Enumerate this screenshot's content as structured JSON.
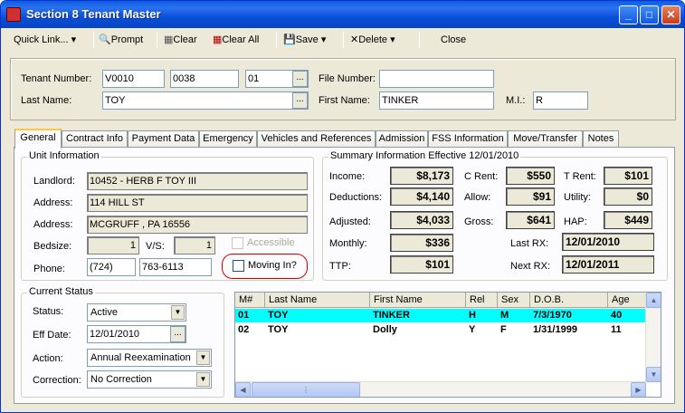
{
  "window": {
    "title": "Section 8 Tenant Master",
    "minimize": "_",
    "maximize": "□",
    "close": "✕"
  },
  "toolbar": {
    "quick_link": "Quick Link...",
    "prompt": "Prompt",
    "clear": "Clear",
    "clear_all": "Clear All",
    "save": "Save",
    "delete": "Delete",
    "close": "Close"
  },
  "header": {
    "tenant_number_label": "Tenant Number:",
    "tenant_number_1": "V0010",
    "tenant_number_2": "0038",
    "tenant_number_3": "01",
    "file_number_label": "File Number:",
    "file_number": "",
    "last_name_label": "Last Name:",
    "last_name": "TOY",
    "first_name_label": "First Name:",
    "first_name": "TINKER",
    "mi_label": "M.I.:",
    "mi": "R",
    "ellipsis": "..."
  },
  "tabs": [
    "General",
    "Contract Info",
    "Payment Data",
    "Emergency",
    "Vehicles and References",
    "Admission",
    "FSS Information",
    "Move/Transfer",
    "Notes"
  ],
  "unit": {
    "group_label": "Unit Information",
    "landlord_label": "Landlord:",
    "landlord": "10452    -  HERB F TOY III",
    "address_label": "Address:",
    "address1": "114 HILL ST",
    "address2_label": "Address:",
    "address2": "MCGRUFF          , PA  16556",
    "bedsize_label": "Bedsize:",
    "bedsize": "1",
    "vs_label": "V/S:",
    "vs": "1",
    "accessible_label": "Accessible",
    "phone_label": "Phone:",
    "phone_area": "(724)",
    "phone_number": "763-6113",
    "moving_in_label": "Moving In?"
  },
  "summary": {
    "group_label": "Summary Information Effective 12/01/2010",
    "income_label": "Income:",
    "income": "$8,173",
    "deductions_label": "Deductions:",
    "deductions": "$4,140",
    "adjusted_label": "Adjusted:",
    "adjusted": "$4,033",
    "monthly_label": "Monthly:",
    "monthly": "$336",
    "ttp_label": "TTP:",
    "ttp": "$101",
    "c_rent_label": "C Rent:",
    "c_rent": "$550",
    "allow_label": "Allow:",
    "allow": "$91",
    "gross_label": "Gross:",
    "gross": "$641",
    "t_rent_label": "T Rent:",
    "t_rent": "$101",
    "utility_label": "Utility:",
    "utility": "$0",
    "hap_label": "HAP:",
    "hap": "$449",
    "last_rx_label": "Last RX:",
    "last_rx": "12/01/2010",
    "next_rx_label": "Next RX:",
    "next_rx": "12/01/2011"
  },
  "status": {
    "group_label": "Current Status",
    "status_label": "Status:",
    "status": "Active",
    "eff_date_label": "Eff Date:",
    "eff_date": "12/01/2010",
    "action_label": "Action:",
    "action": "Annual Reexamination",
    "correction_label": "Correction:",
    "correction": "No Correction"
  },
  "members": {
    "columns": [
      "M#",
      "Last Name",
      "First Name",
      "Rel",
      "Sex",
      "D.O.B.",
      "Age"
    ],
    "rows": [
      [
        "01",
        "TOY",
        "TINKER",
        "H",
        "M",
        "7/3/1970",
        "40"
      ],
      [
        "02",
        "TOY",
        "Dolly",
        "Y",
        "F",
        "1/31/1999",
        "11"
      ]
    ]
  },
  "colors": {
    "titlebar": "#0a50d8",
    "selected_row": "#00ffff",
    "moving_in_highlight": "#cc0000"
  }
}
